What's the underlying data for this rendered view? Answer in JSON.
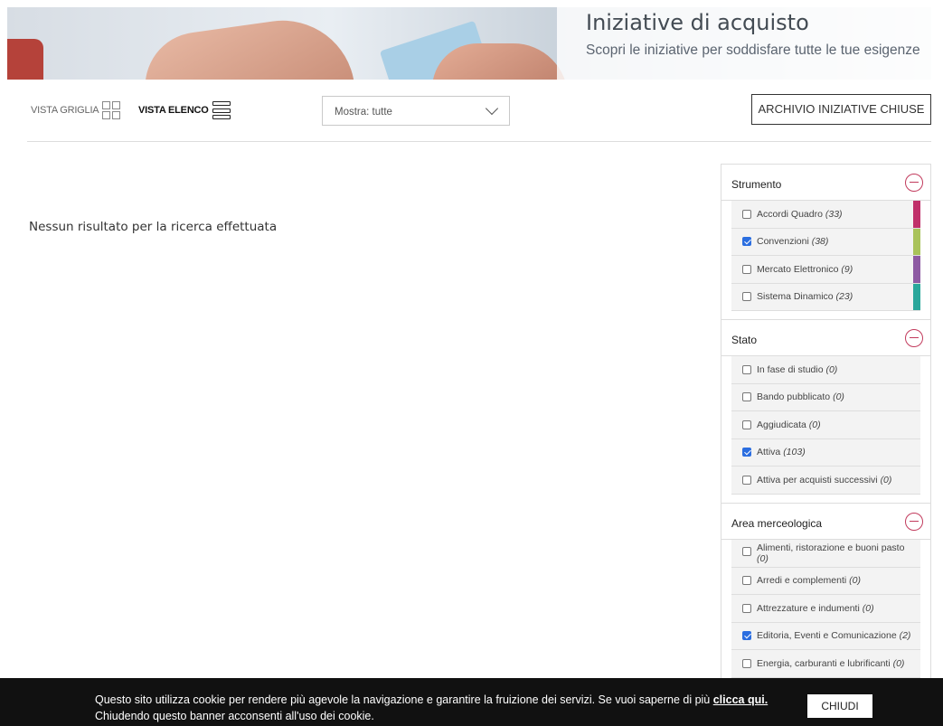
{
  "hero": {
    "title": "Iniziative di acquisto",
    "subtitle": "Scopri le iniziative per soddisfare tutte le tue esigenze"
  },
  "toolbar": {
    "grid_view_label": "VISTA GRIGLIA",
    "list_view_label": "VISTA ELENCO",
    "filter_select_value": "Mostra: tutte",
    "archive_button_label": "ARCHIVIO INIZIATIVE CHIUSE"
  },
  "results": {
    "empty_message": "Nessun risultato per la ricerca effettuata"
  },
  "filters": {
    "strumento": {
      "title": "Strumento",
      "items": [
        {
          "label": "Accordi Quadro",
          "count": "(33)",
          "checked": false,
          "color": "#c0306a"
        },
        {
          "label": "Convenzioni",
          "count": "(38)",
          "checked": true,
          "color": "#a9c35a"
        },
        {
          "label": "Mercato Elettronico",
          "count": "(9)",
          "checked": false,
          "color": "#8e5aa3"
        },
        {
          "label": "Sistema Dinamico",
          "count": "(23)",
          "checked": false,
          "color": "#2aa79b"
        }
      ]
    },
    "stato": {
      "title": "Stato",
      "items": [
        {
          "label": "In fase di studio",
          "count": "(0)",
          "checked": false
        },
        {
          "label": "Bando pubblicato",
          "count": "(0)",
          "checked": false
        },
        {
          "label": "Aggiudicata",
          "count": "(0)",
          "checked": false
        },
        {
          "label": "Attiva",
          "count": "(103)",
          "checked": true
        },
        {
          "label": "Attiva per acquisti successivi",
          "count": "(0)",
          "checked": false
        }
      ]
    },
    "area": {
      "title": "Area merceologica",
      "items": [
        {
          "label": "Alimenti, ristorazione e buoni pasto",
          "count": "(0)",
          "checked": false
        },
        {
          "label": "Arredi e complementi",
          "count": "(0)",
          "checked": false
        },
        {
          "label": "Attrezzature e indumenti",
          "count": "(0)",
          "checked": false
        },
        {
          "label": "Editoria, Eventi e Comunicazione",
          "count": "(2)",
          "checked": true
        },
        {
          "label": "Energia, carburanti e lubrificanti",
          "count": "(0)",
          "checked": false
        }
      ]
    }
  },
  "cookie": {
    "text_part1": "Questo sito utilizza cookie per rendere più agevole la navigazione e garantire la fruizione dei servizi. Se vuoi saperne di più ",
    "link_label": "clicca qui.",
    "text_part2": "Chiudendo questo banner acconsenti all'uso dei cookie.",
    "close_label": "CHIUDI"
  }
}
